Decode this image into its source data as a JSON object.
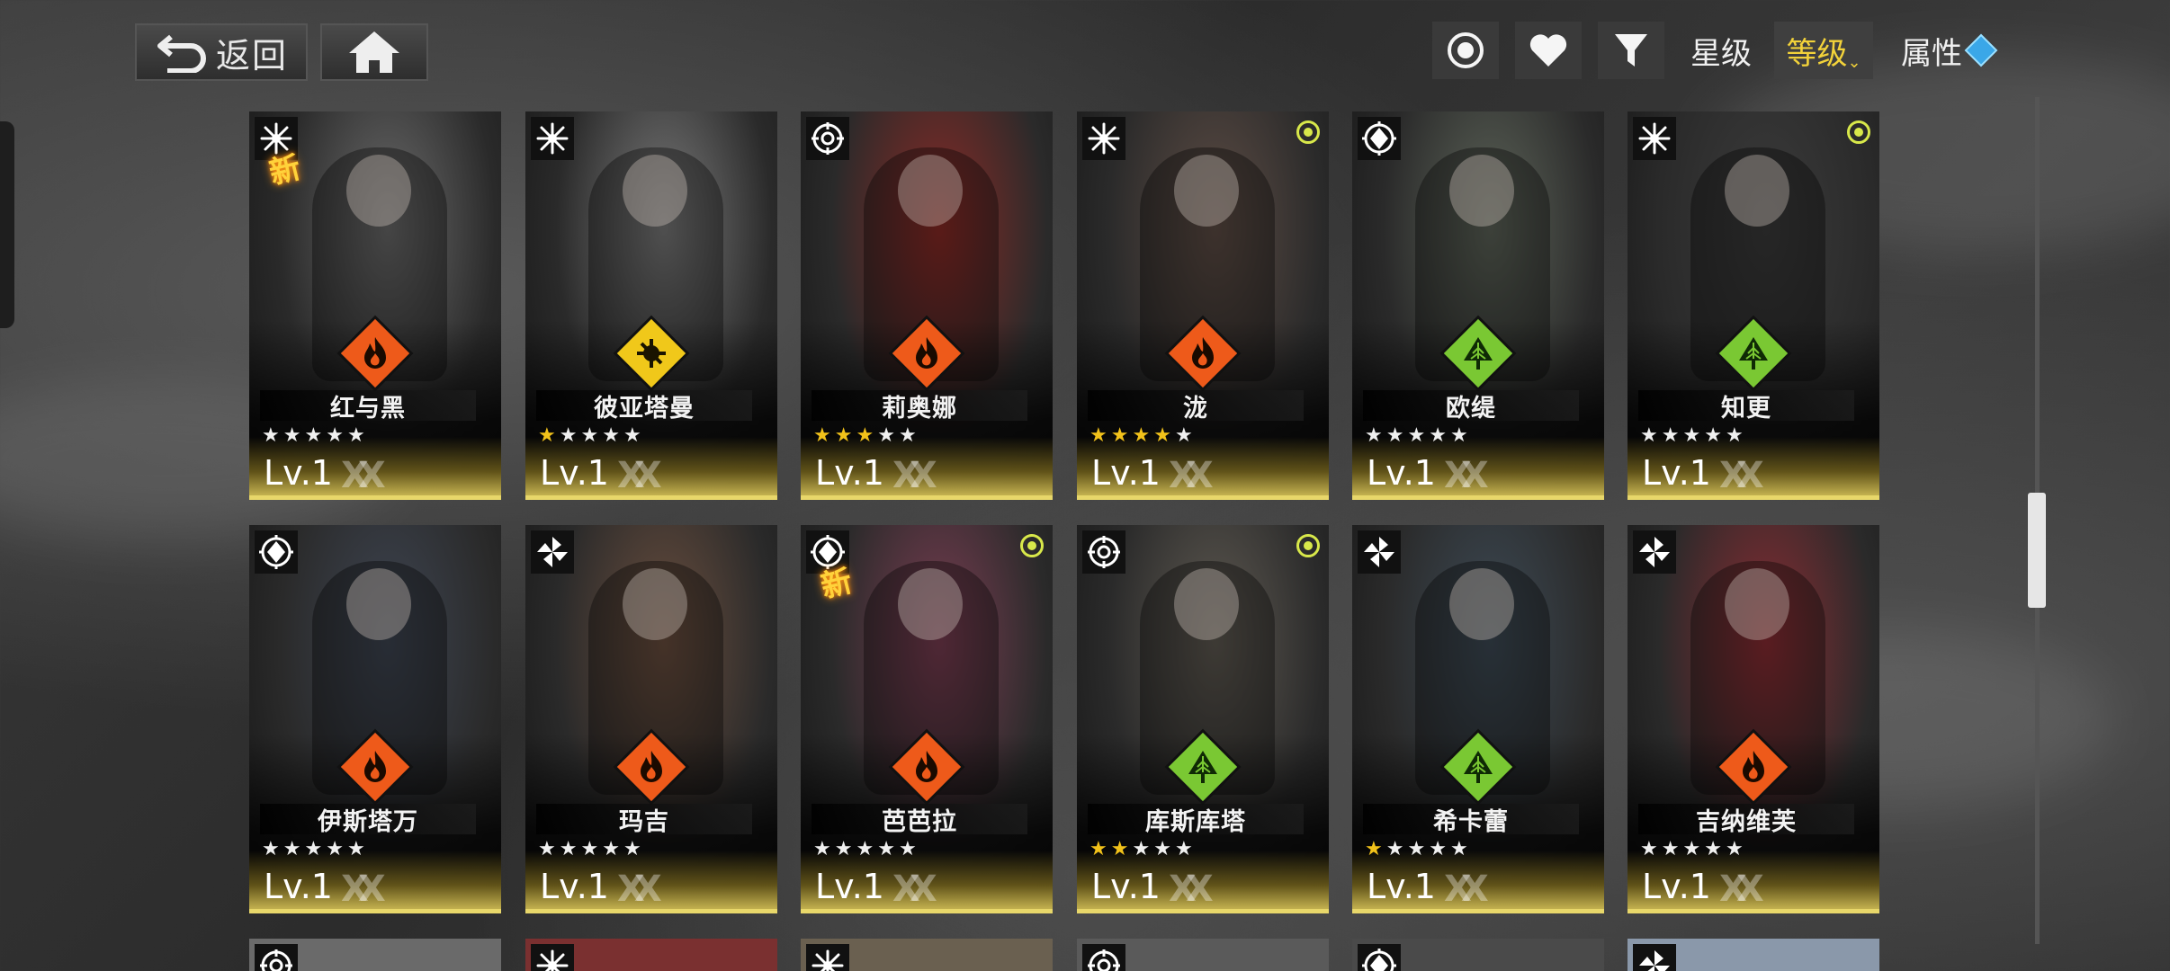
{
  "topbar": {
    "back_label": "返回",
    "sort_star": "星级",
    "sort_level": "等级",
    "sort_attr": "属性"
  },
  "colors": {
    "accent_gold": "#f2d23a",
    "fire": "#ee5a1a",
    "electric": "#f0c81a",
    "nature": "#7ac833"
  },
  "rows": [
    [
      {
        "name": "红与黑",
        "stars": 0,
        "level": "Lv.1",
        "element": "fire",
        "badge": "snowflake",
        "new": "新",
        "dot": false,
        "hue": "#6b6b6b"
      },
      {
        "name": "彼亚塔曼",
        "stars": 1,
        "level": "Lv.1",
        "element": "electric",
        "badge": "snowflake",
        "new": "",
        "dot": false,
        "hue": "#7a7a7a"
      },
      {
        "name": "莉奥娜",
        "stars": 3,
        "level": "Lv.1",
        "element": "fire",
        "badge": "target",
        "new": "",
        "dot": false,
        "hue": "#8a2a26"
      },
      {
        "name": "泷",
        "stars": 4,
        "level": "Lv.1",
        "element": "fire",
        "badge": "snowflake",
        "new": "",
        "dot": true,
        "hue": "#5e4d45"
      },
      {
        "name": "欧缇",
        "stars": 0,
        "level": "Lv.1",
        "element": "nature",
        "badge": "shield",
        "new": "",
        "dot": false,
        "hue": "#5d6459"
      },
      {
        "name": "知更",
        "stars": 0,
        "level": "Lv.1",
        "element": "nature",
        "badge": "snowflake",
        "new": "",
        "dot": true,
        "hue": "#3b3b3b"
      }
    ],
    [
      {
        "name": "伊斯塔万",
        "stars": 0,
        "level": "Lv.1",
        "element": "fire",
        "badge": "shield",
        "new": "",
        "dot": false,
        "hue": "#3e4552"
      },
      {
        "name": "玛吉",
        "stars": 0,
        "level": "Lv.1",
        "element": "fire",
        "badge": "pinwheel",
        "new": "",
        "dot": false,
        "hue": "#6a4e3e"
      },
      {
        "name": "芭芭拉",
        "stars": 0,
        "level": "Lv.1",
        "element": "fire",
        "badge": "shield",
        "new": "新",
        "dot": true,
        "hue": "#7a3d52"
      },
      {
        "name": "库斯库塔",
        "stars": 2,
        "level": "Lv.1",
        "element": "nature",
        "badge": "target",
        "new": "",
        "dot": true,
        "hue": "#5f5a52"
      },
      {
        "name": "希卡蕾",
        "stars": 1,
        "level": "Lv.1",
        "element": "nature",
        "badge": "pinwheel",
        "new": "",
        "dot": false,
        "hue": "#3d4a55"
      },
      {
        "name": "吉纳维芙",
        "stars": 0,
        "level": "Lv.1",
        "element": "fire",
        "badge": "pinwheel",
        "new": "",
        "dot": false,
        "hue": "#8a2c33"
      }
    ]
  ],
  "partial_row_badges": [
    "target",
    "snowflake",
    "snowflake",
    "target",
    "shield",
    "pinwheel"
  ]
}
